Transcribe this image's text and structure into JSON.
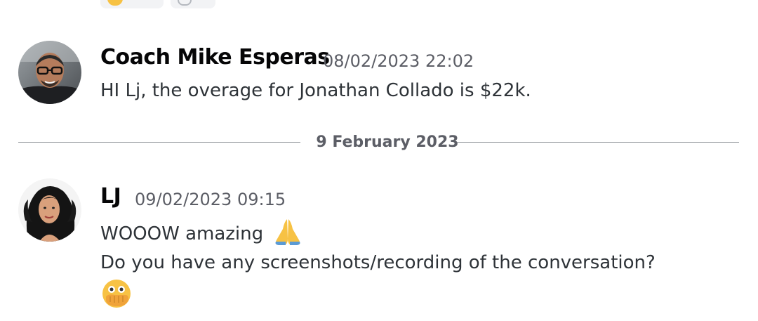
{
  "messages": [
    {
      "author": "Coach Mike Esperas",
      "timestamp": "08/02/2023 22:02",
      "lines": [
        "HI Lj, the overage for Jonathan Collado is $22k."
      ],
      "avatar_icon": "avatar-photo-man"
    },
    {
      "author": "LJ",
      "timestamp": "09/02/2023 09:15",
      "lines": [
        "WOOOW amazing",
        "Do you have any screenshots/recording of the conversation?"
      ],
      "avatar_icon": "avatar-photo-woman",
      "emojis": [
        "folded-hands-emoji",
        "face-with-hand-over-mouth-emoji"
      ]
    }
  ],
  "divider": {
    "label": "9 February 2023"
  },
  "reactions": [
    {
      "icon": "reaction-emoji"
    },
    {
      "icon": "reaction-emoji"
    }
  ],
  "colors": {
    "author": "#060607",
    "text": "#2e3338",
    "timestamp": "#5c5e66",
    "divider": "#8e9297"
  }
}
